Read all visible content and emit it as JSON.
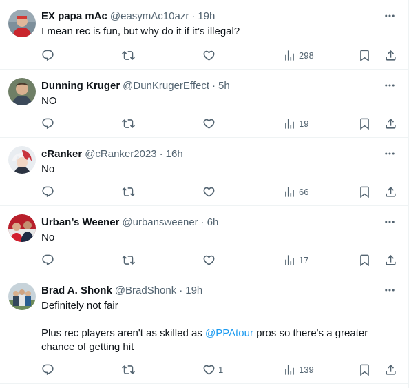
{
  "tweets": [
    {
      "name": "EX papa mAc",
      "handle": "@easymAc10azr",
      "dot": "·",
      "time": "19h",
      "text": [
        "I mean rec is fun, but why do it if it’s illegal?"
      ],
      "replies": "",
      "retweets": "",
      "likes": "",
      "views": "298",
      "avatar_icon": "avatar-red-shirt"
    },
    {
      "name": "Dunning Kruger",
      "handle": "@DunKrugerEffect",
      "dot": "·",
      "time": "5h",
      "text": [
        "NO"
      ],
      "replies": "",
      "retweets": "",
      "likes": "",
      "views": "19",
      "avatar_icon": "avatar-man-portrait"
    },
    {
      "name": "cRanker",
      "handle": "@cRanker2023",
      "dot": "·",
      "time": "16h",
      "text": [
        "No"
      ],
      "replies": "",
      "retweets": "",
      "likes": "",
      "views": "66",
      "avatar_icon": "avatar-anime-character"
    },
    {
      "name": "Urban’s Weener",
      "handle": "@urbansweener",
      "dot": "·",
      "time": "6h",
      "text": [
        "No"
      ],
      "replies": "",
      "retweets": "",
      "likes": "",
      "views": "17",
      "avatar_icon": "avatar-sports-team"
    },
    {
      "name": "Brad A. Shonk",
      "handle": "@BradShonk",
      "dot": "·",
      "time": "19h",
      "text": [
        "Definitely not fair"
      ],
      "text2_before": "Plus rec players aren't as skilled as ",
      "text2_mention": "@PPAtour",
      "text2_after": " pros so there's a greater chance of getting hit",
      "replies": "",
      "retweets": "",
      "likes": "1",
      "views": "139",
      "avatar_icon": "avatar-group-photo"
    }
  ],
  "colors": {
    "text": "#0f1419",
    "secondary": "#536471",
    "link": "#1d9bf0",
    "divider": "#eff3f4"
  }
}
